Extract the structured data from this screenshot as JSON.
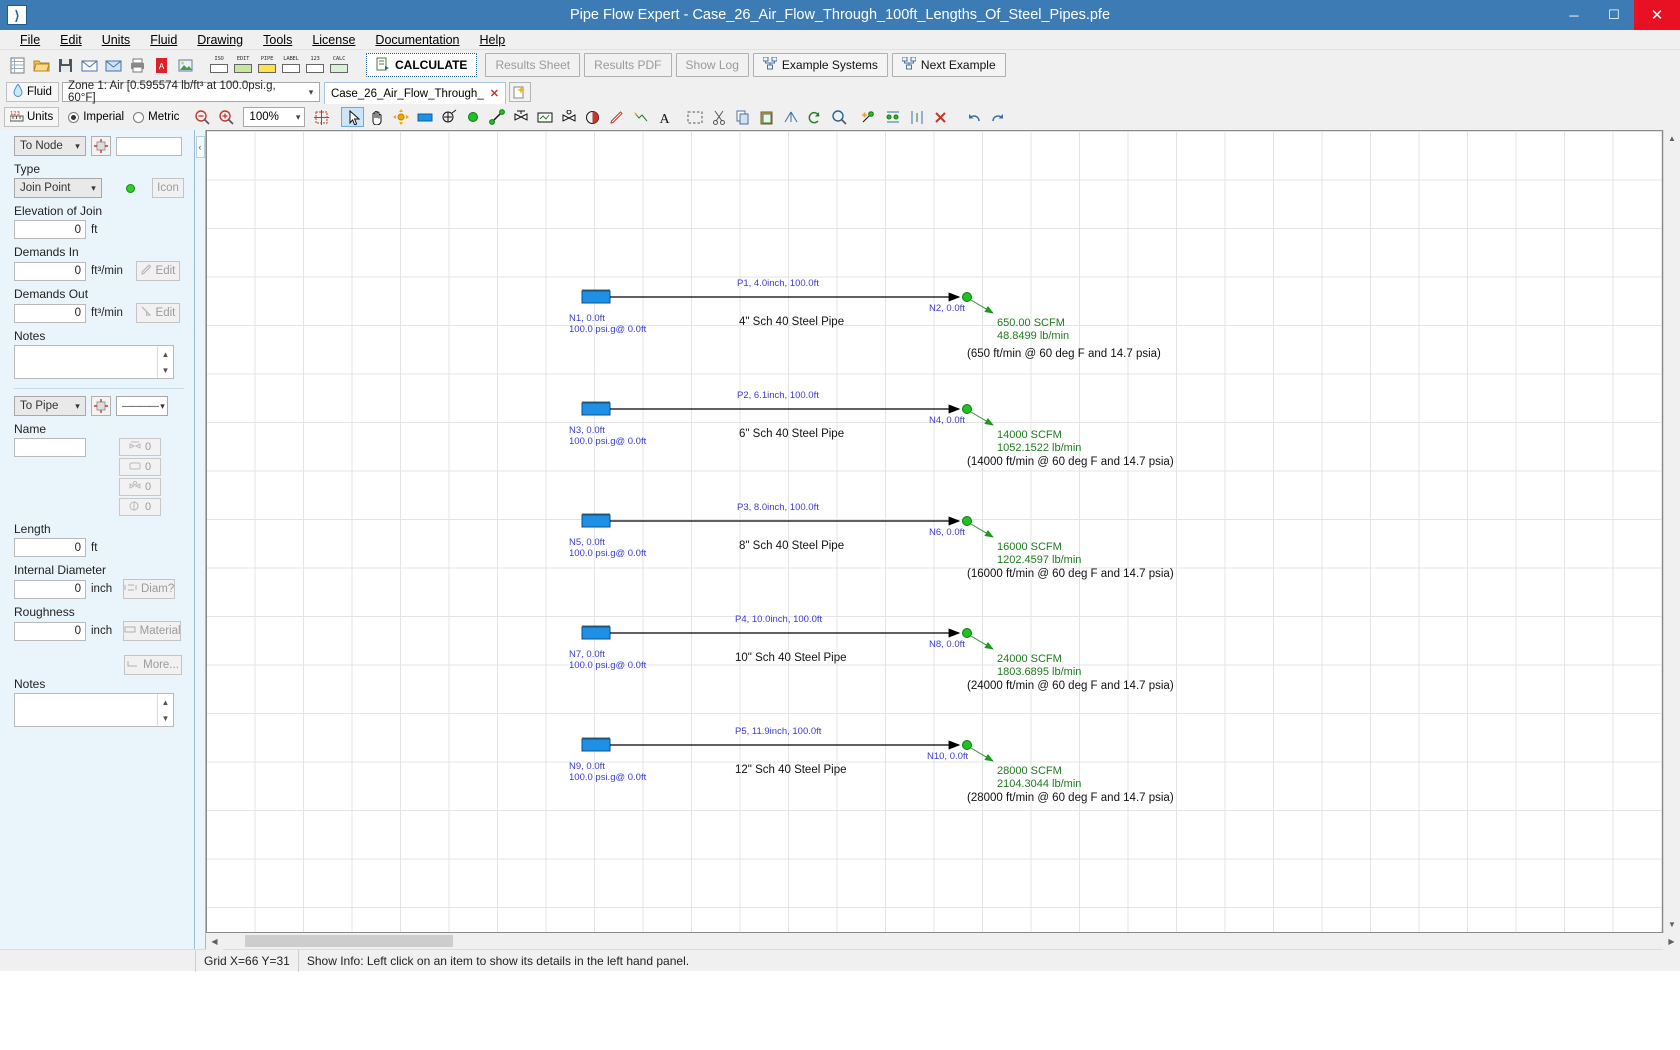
{
  "window": {
    "title": "Pipe Flow Expert - Case_26_Air_Flow_Through_100ft_Lengths_Of_Steel_Pipes.pfe",
    "logo_glyph": "⟩",
    "minimize": "─",
    "maximize": "☐",
    "close": "✕"
  },
  "menu": [
    {
      "label": "File",
      "accel": "F"
    },
    {
      "label": "Edit",
      "accel": "E"
    },
    {
      "label": "Units",
      "accel": "U"
    },
    {
      "label": "Fluid",
      "accel": "F"
    },
    {
      "label": "Drawing",
      "accel": "D"
    },
    {
      "label": "Tools",
      "accel": "T"
    },
    {
      "label": "License",
      "accel": "i"
    },
    {
      "label": "Documentation",
      "accel": "D"
    },
    {
      "label": "Help",
      "accel": "H"
    }
  ],
  "toolbar": {
    "icons": [
      {
        "name": "new-file-icon"
      },
      {
        "name": "open-folder-icon"
      },
      {
        "name": "save-icon"
      },
      {
        "name": "email-icon"
      },
      {
        "name": "export-icon"
      },
      {
        "name": "print-icon"
      },
      {
        "name": "pdf-icon"
      },
      {
        "name": "image-export-icon"
      }
    ],
    "label_icons": [
      {
        "name": "iso-view-icon",
        "text": "ISO"
      },
      {
        "name": "edit-mode-icon",
        "text": "EDIT"
      },
      {
        "name": "pipe-icon",
        "text": "PIPE"
      },
      {
        "name": "label-icon",
        "text": "LABEL"
      },
      {
        "name": "numbers-icon",
        "text": "123"
      },
      {
        "name": "calc-icon",
        "text": "CALC"
      }
    ],
    "calculate_label": "CALCULATE",
    "results_sheet_label": "Results Sheet",
    "results_pdf_label": "Results PDF",
    "show_log_label": "Show Log",
    "example_systems_label": "Example Systems",
    "next_example_label": "Next Example"
  },
  "fluidbar": {
    "fluid_button_label": "Fluid",
    "zone_value": "Zone 1: Air [0.595574 lb/ft³ at 100.0psi.g, 60°F]",
    "tab_label": "Case_26_Air_Flow_Through_",
    "tab_close": "✕",
    "new_tab_icon": "new-document-icon"
  },
  "drawbar": {
    "units_button_label": "Units",
    "imperial_label": "Imperial",
    "metric_label": "Metric",
    "imperial_selected": true,
    "zoom_value": "100%",
    "tools": [
      {
        "name": "zoom-out-icon"
      },
      {
        "name": "zoom-in-icon"
      },
      {
        "name": "zoom-level-select"
      },
      {
        "name": "fit-to-window-icon"
      },
      {
        "name": "select-arrow-tool",
        "selected": true
      },
      {
        "name": "pan-hand-tool"
      },
      {
        "name": "move-node-tool"
      },
      {
        "name": "tank-tool"
      },
      {
        "name": "pump-tool"
      },
      {
        "name": "join-point-tool"
      },
      {
        "name": "pipe-tool"
      },
      {
        "name": "valve-tool"
      },
      {
        "name": "flow-meter-tool"
      },
      {
        "name": "control-valve-tool"
      },
      {
        "name": "check-valve-tool"
      },
      {
        "name": "pencil-tool"
      },
      {
        "name": "graph-tool"
      },
      {
        "name": "text-tool"
      },
      {
        "name": "marquee-select-tool"
      },
      {
        "name": "cut-icon"
      },
      {
        "name": "copy-icon"
      },
      {
        "name": "paste-icon"
      },
      {
        "name": "flip-horizontal-icon"
      },
      {
        "name": "rotate-icon"
      },
      {
        "name": "zoom-selection-icon"
      },
      {
        "name": "add-node-icon"
      },
      {
        "name": "align-nodes-icon"
      },
      {
        "name": "distribute-icon"
      },
      {
        "name": "delete-icon"
      },
      {
        "name": "undo-icon"
      },
      {
        "name": "redo-icon"
      }
    ]
  },
  "left_panel": {
    "node_section": {
      "goto_select": "To Node",
      "goto_arrow": "⌄",
      "pick_icon": "crosshair-picker-icon",
      "name_value": "",
      "type_label": "Type",
      "type_value": "Join Point",
      "status_dot": "join-point-indicator",
      "icon_button_label": "Icon",
      "elevation_label": "Elevation of Join",
      "elevation_value": "0",
      "elevation_unit": "ft",
      "demands_in_label": "Demands In",
      "demands_in_value": "0",
      "demands_in_unit": "ft³/min",
      "demands_in_edit": "Edit",
      "demands_out_label": "Demands Out",
      "demands_out_value": "0",
      "demands_out_unit": "ft³/min",
      "demands_out_edit": "Edit",
      "notes_label": "Notes",
      "notes_value": ""
    },
    "pipe_section": {
      "goto_select": "To Pipe",
      "goto_arrow": "⌄",
      "pick_icon": "crosshair-picker-icon",
      "line_style_value": "————",
      "name_label": "Name",
      "name_value": "",
      "length_label": "Length",
      "length_value": "0",
      "length_unit": "ft",
      "internal_diameter_label": "Internal Diameter",
      "internal_diameter_value": "0",
      "internal_diameter_unit": "inch",
      "diam_button_label": "Diam?",
      "roughness_label": "Roughness",
      "roughness_value": "0",
      "roughness_unit": "inch",
      "material_button_label": "Material",
      "more_button_label": "More...",
      "notes_label": "Notes",
      "notes_value": "",
      "counters": [
        {
          "name": "fittings-count",
          "value": "0"
        },
        {
          "name": "components-count",
          "value": "0"
        },
        {
          "name": "valves-count",
          "value": "0"
        },
        {
          "name": "control-count",
          "value": "0"
        }
      ]
    }
  },
  "statusbar": {
    "grid": "Grid  X=66  Y=31",
    "info": "Show Info: Left click on an item to show its details in the left hand panel."
  },
  "diagram": {
    "rows": [
      {
        "pipe_label": "P1, 4.0inch, 100.0ft",
        "desc": "4\" Sch 40 Steel Pipe",
        "start_node": "N1, 0.0ft",
        "start_pressure": "100.0 psi.g@ 0.0ft",
        "end_node": "N2, 0.0ft",
        "flow_scfm": "650.00 SCFM",
        "flow_mass": "48.8499 lb/min",
        "flow_paren": "(650 ft/min @ 60 deg F and 14.7 psia)"
      },
      {
        "pipe_label": "P2, 6.1inch, 100.0ft",
        "desc": "6\" Sch 40 Steel Pipe",
        "start_node": "N3, 0.0ft",
        "start_pressure": "100.0 psi.g@ 0.0ft",
        "end_node": "N4, 0.0ft",
        "flow_scfm": "14000 SCFM",
        "flow_mass": "1052.1522 lb/min",
        "flow_paren": "(14000 ft/min @ 60 deg F and 14.7 psia)"
      },
      {
        "pipe_label": "P3, 8.0inch, 100.0ft",
        "desc": "8\" Sch 40 Steel Pipe",
        "start_node": "N5, 0.0ft",
        "start_pressure": "100.0 psi.g@ 0.0ft",
        "end_node": "N6, 0.0ft",
        "flow_scfm": "16000 SCFM",
        "flow_mass": "1202.4597 lb/min",
        "flow_paren": "(16000 ft/min @ 60 deg F and 14.7 psia)"
      },
      {
        "pipe_label": "P4, 10.0inch, 100.0ft",
        "desc": "10\" Sch 40 Steel Pipe",
        "start_node": "N7, 0.0ft",
        "start_pressure": "100.0 psi.g@ 0.0ft",
        "end_node": "N8, 0.0ft",
        "flow_scfm": "24000 SCFM",
        "flow_mass": "1803.6895 lb/min",
        "flow_paren": "(24000 ft/min @ 60 deg F and 14.7 psia)"
      },
      {
        "pipe_label": "P5, 11.9inch, 100.0ft",
        "desc": "12\" Sch 40 Steel Pipe",
        "start_node": "N9, 0.0ft",
        "start_pressure": "100.0 psi.g@ 0.0ft",
        "end_node": "N10, 0.0ft",
        "flow_scfm": "28000 SCFM",
        "flow_mass": "2104.3044 lb/min",
        "flow_paren": "(28000 ft/min @ 60 deg F and 14.7 psia)"
      }
    ]
  },
  "colors": {
    "titlebar": "#3d7bb5",
    "close_button": "#e81123",
    "node_text": "#3a3ad0",
    "flow_text": "#1f7a1f",
    "tank_fill": "#1e90e8",
    "join_dot": "#22c022",
    "panel_bg": "#eaf4fb"
  }
}
